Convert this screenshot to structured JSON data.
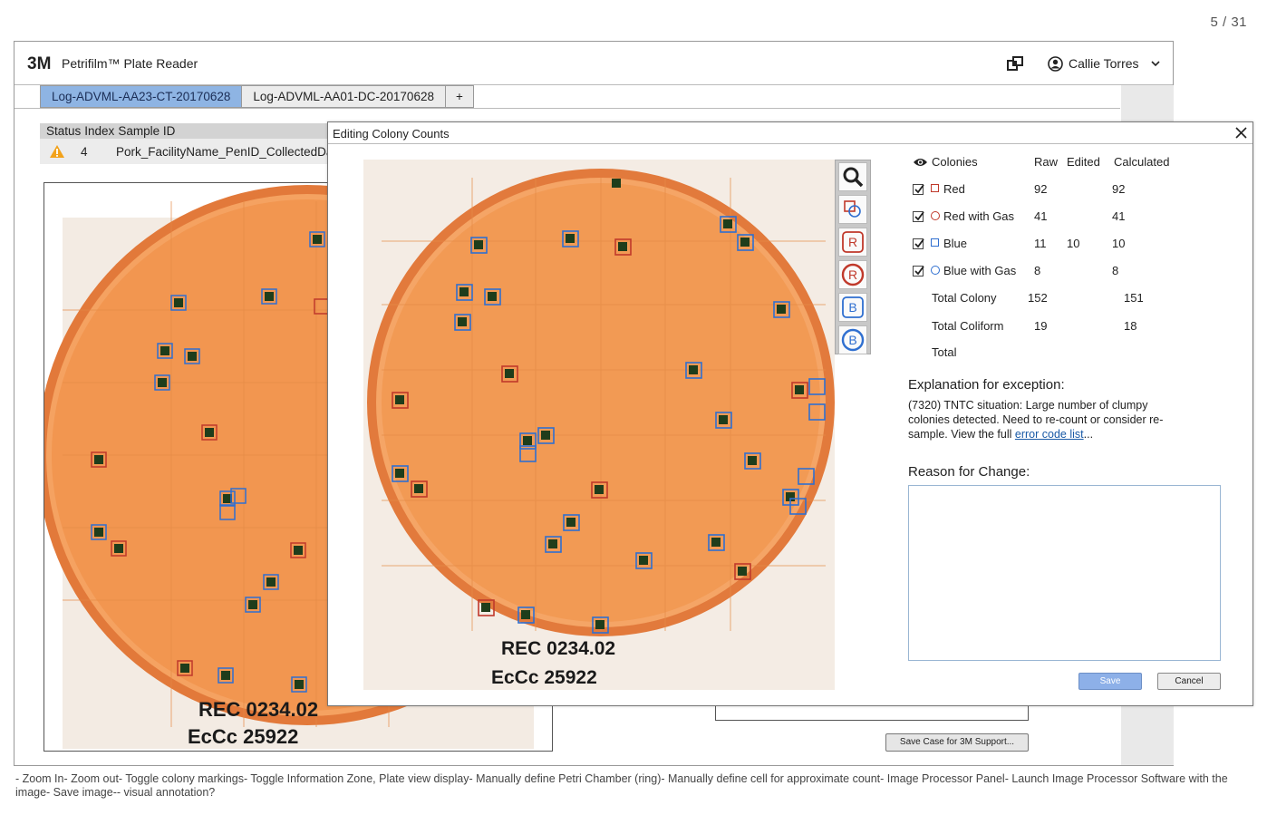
{
  "page_counter": "5 / 31",
  "app": {
    "brand": "3M",
    "title": "Petrifilm™ Plate Reader",
    "user_name": "Callie Torres"
  },
  "tabs": [
    {
      "label": "Log-ADVML-AA23-CT-20170628",
      "active": true
    },
    {
      "label": "Log-ADVML-AA01-DC-20170628",
      "active": false
    },
    {
      "label": "+",
      "active": false
    }
  ],
  "status_table": {
    "headers": [
      "Status",
      "Index",
      "Sample ID"
    ],
    "row": {
      "index": "4",
      "sample_id": "Pork_FacilityName_PenID_CollectedDate"
    }
  },
  "plate_labels": {
    "line1": "REC 0234.02",
    "line2": "EcCc 25922"
  },
  "support_button": "Save Case for 3M Support...",
  "dialog": {
    "title": "Editing Colony Counts",
    "tools": [
      "zoom-icon",
      "toggle-markings-icon",
      "red-colony-icon",
      "red-gas-colony-icon",
      "blue-colony-icon",
      "blue-gas-colony-icon"
    ],
    "tool_letters": {
      "red": "R",
      "blue": "B"
    },
    "counts_headers": {
      "colonies": "Colonies",
      "raw": "Raw",
      "edited": "Edited",
      "calculated": "Calculated"
    },
    "counts_rows": [
      {
        "label": "Red",
        "raw": "92",
        "edited": "",
        "calculated": "92",
        "checked": true
      },
      {
        "label": "Red with Gas",
        "raw": "41",
        "edited": "",
        "calculated": "41",
        "checked": true
      },
      {
        "label": "Blue",
        "raw": "11",
        "edited": "10",
        "calculated": "10",
        "checked": true
      },
      {
        "label": "Blue with Gas",
        "raw": "8",
        "edited": "",
        "calculated": "8",
        "checked": true
      }
    ],
    "totals": [
      {
        "label": "Total Colony",
        "raw": "152",
        "calculated": "151"
      },
      {
        "label": "Total Coliform",
        "raw": "19",
        "calculated": "18"
      },
      {
        "label": "Total",
        "raw": "",
        "calculated": ""
      }
    ],
    "explanation_heading": "Explanation for exception:",
    "explanation_text": "(7320) TNTC situation: Large number of clumpy colonies detected. Need to re-count or consider re-sample.   View the full ",
    "explanation_link": "error code list",
    "explanation_suffix": "...",
    "reason_heading": "Reason for Change:",
    "reason_value": "",
    "save_label": "Save",
    "cancel_label": "Cancel"
  },
  "colors": {
    "red_marker": "#c0392b",
    "blue_marker": "#2f6fd0",
    "plate_orange": "#f29a4b",
    "active_tab": "#8eb4e3"
  },
  "footer_note": "- Zoom In- Zoom out- Toggle colony markings- Toggle Information Zone, Plate view display- Manually define Petri Chamber (ring)- Manually define cell for approximate count- Image Processor Panel- Launch Image Processor Software with the image- Save image-- visual annotation?"
}
